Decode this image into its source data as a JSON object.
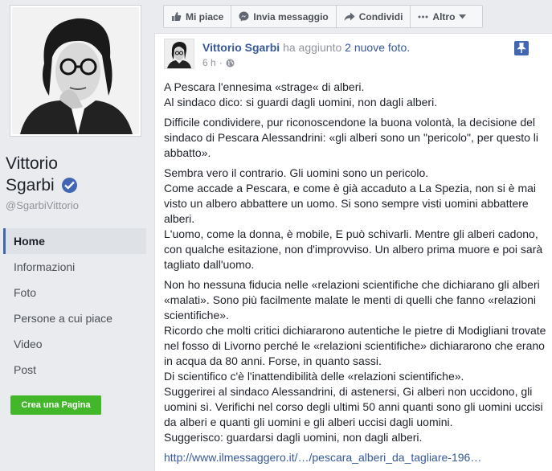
{
  "page": {
    "name_line1": "Vittorio",
    "name_line2": "Sgarbi",
    "handle": "@SgarbiVittorio"
  },
  "nav": [
    {
      "label": "Home"
    },
    {
      "label": "Informazioni"
    },
    {
      "label": "Foto"
    },
    {
      "label": "Persone a cui piace"
    },
    {
      "label": "Video"
    },
    {
      "label": "Post"
    }
  ],
  "create_page_label": "Crea una Pagina",
  "actions": {
    "like": "Mi piace",
    "message": "Invia messaggio",
    "share": "Condividi",
    "more": "Altro"
  },
  "post": {
    "author": "Vittorio Sgarbi",
    "action_text": "ha aggiunto",
    "photos_text": "2 nuove foto.",
    "time": "6 h",
    "paragraphs": [
      "A Pescara l'ennesima «strage« di alberi.\nAl sindaco dico: si guardi dagli uomini, non dagli alberi.",
      "Difficile condividere, pur riconoscendone la buona volontà, la decisione del sindaco di Pescara Alessandrini: «gli alberi sono un \"pericolo\", per questo li abbatto».",
      "Sembra vero il contrario. Gli uomini sono un pericolo.\nCome accade a Pescara, e come è già accaduto a La Spezia, non si è mai visto un albero abbattere un uomo. Si sono sempre visti uomini abbattere alberi.\nL'uomo, come la donna, è mobile, E può schivarli. Mentre gli alberi cadono, con qualche esitazione, non d'improvviso. Un albero prima muore e poi sarà tagliato dall'uomo.",
      "Non ho nessuna fiducia nelle «relazioni scientifiche che dichiarano gli alberi «malati». Sono più facilmente malate le menti di quelli che fanno «relazioni scientifiche».\nRicordo che molti critici dichiararono autentiche le pietre di Modigliani trovate nel fosso di Livorno perché le «relazioni scientifiche» dichiararono che erano in acqua da 80 anni. Forse, in quanto sassi.\nDi scientifico c'è l'inattendibilità delle «relazioni scientifiche».\nSuggerirei al sindaco Alessandrini, di astenersi, Gi alberi non uccidono, gli uomini sì. Verifichi nel corso degli ultimi 50 anni quanti sono gli uomini uccisi da alberi e quanti gli uomini e gli alberi uccisi dagli uomini.\nSuggerisco: guardarsi dagli uomini, non dagli alberi."
    ],
    "link": "http://www.ilmessaggero.it/…/pescara_alberi_da_tagliare-196…"
  },
  "colors": {
    "brand_blue": "#4267b2",
    "link_blue": "#365899",
    "green": "#42b72a",
    "background": "#e9ebee"
  }
}
